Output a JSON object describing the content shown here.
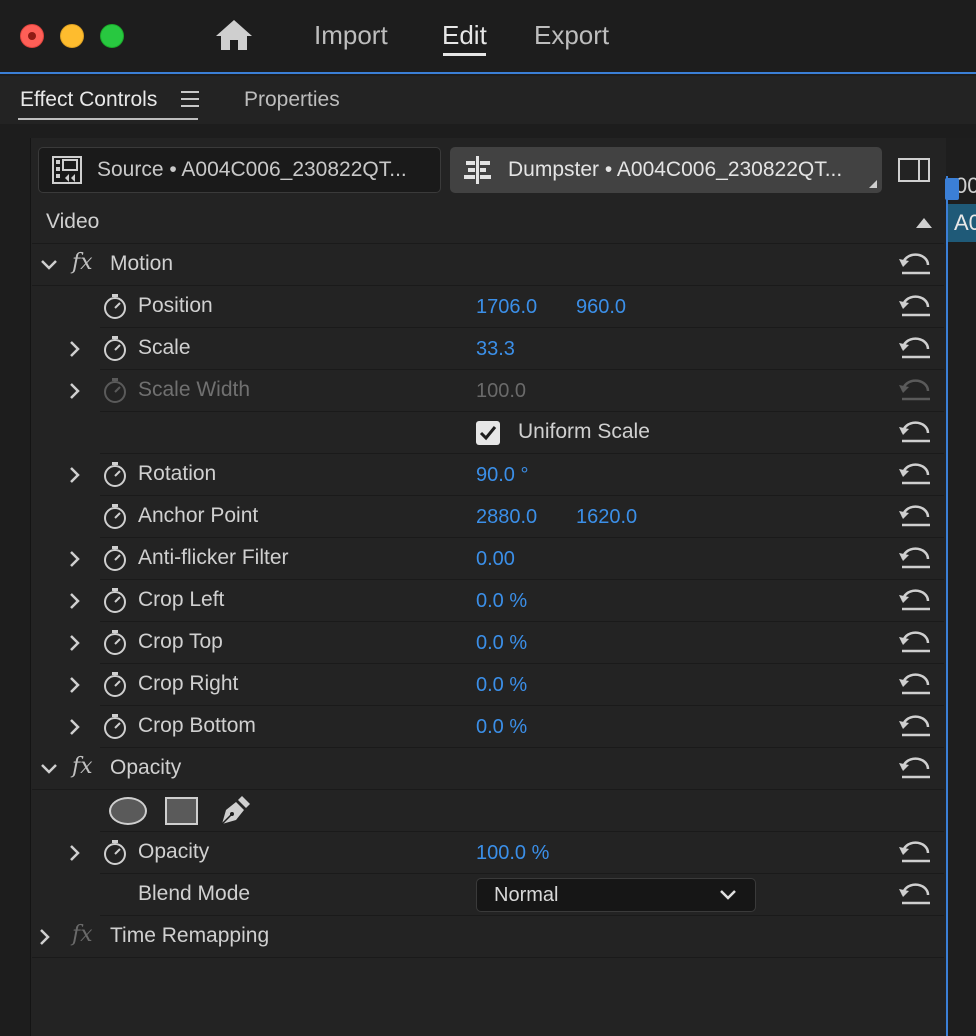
{
  "window": {
    "nav": [
      "Import",
      "Edit",
      "Export"
    ],
    "active_nav": "Edit"
  },
  "panel": {
    "tabs": [
      "Effect Controls",
      "Properties"
    ],
    "active_tab": "Effect Controls"
  },
  "clips": {
    "source": "Source • A004C006_230822QT...",
    "sequence": "Dumpster • A004C006_230822QT..."
  },
  "timeline": {
    "timecode_fragment": "00",
    "clip_fragment": "A0"
  },
  "section": {
    "video": "Video"
  },
  "motion": {
    "fx": "fx",
    "name": "Motion",
    "position": {
      "label": "Position",
      "x": "1706.0",
      "y": "960.0"
    },
    "scale": {
      "label": "Scale",
      "value": "33.3"
    },
    "scale_width": {
      "label": "Scale Width",
      "value": "100.0"
    },
    "uniform_scale": {
      "label": "Uniform Scale",
      "checked": true
    },
    "rotation": {
      "label": "Rotation",
      "value": "90.0 °"
    },
    "anchor_point": {
      "label": "Anchor Point",
      "x": "2880.0",
      "y": "1620.0"
    },
    "anti_flicker": {
      "label": "Anti-flicker Filter",
      "value": "0.00"
    },
    "crop_left": {
      "label": "Crop Left",
      "value": "0.0 %"
    },
    "crop_top": {
      "label": "Crop Top",
      "value": "0.0 %"
    },
    "crop_right": {
      "label": "Crop Right",
      "value": "0.0 %"
    },
    "crop_bottom": {
      "label": "Crop Bottom",
      "value": "0.0 %"
    }
  },
  "opacity": {
    "fx": "fx",
    "name": "Opacity",
    "opacity": {
      "label": "Opacity",
      "value": "100.0 %"
    },
    "blend_mode": {
      "label": "Blend Mode",
      "value": "Normal"
    }
  },
  "time_remapping": {
    "fx": "fx",
    "name": "Time Remapping"
  },
  "colors": {
    "accent": "#3b7fd6",
    "value_blue": "#3b8fe8",
    "panel_bg": "#232323"
  }
}
